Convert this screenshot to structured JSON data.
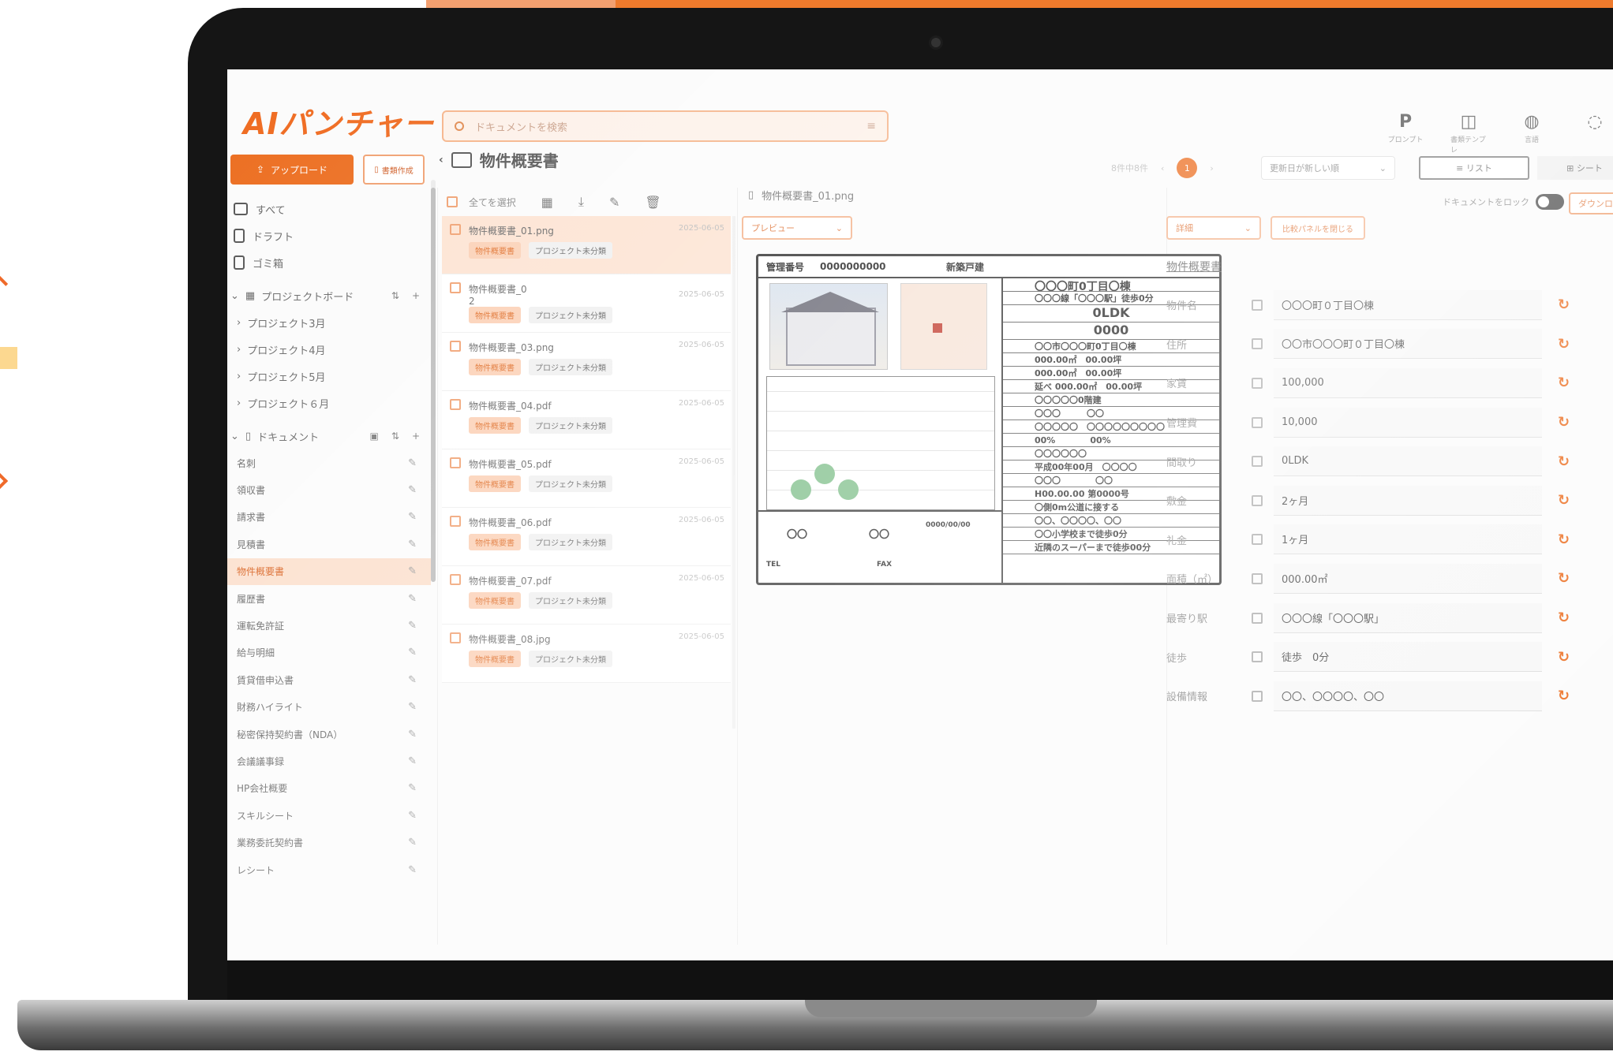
{
  "app": {
    "logo": "AIパンチャー"
  },
  "search": {
    "placeholder": "ドキュメントを検索",
    "menu_glyph": "≡"
  },
  "top_tools": [
    {
      "glyph": "P",
      "label": "プロンプト"
    },
    {
      "glyph": "◫",
      "label": "書類テンプレ"
    },
    {
      "glyph": "◍",
      "label": "言語"
    },
    {
      "glyph": "◌",
      "label": ""
    }
  ],
  "actions": {
    "upload": "アップロード",
    "create_doc": "書類作成"
  },
  "sidebar": {
    "nav": [
      {
        "label": "すべて"
      },
      {
        "label": "ドラフト"
      },
      {
        "label": "ゴミ箱"
      }
    ],
    "project_board": {
      "title": "プロジェクトボード",
      "items": [
        "プロジェクト3月",
        "プロジェクト4月",
        "プロジェクト5月",
        "プロジェクト６月"
      ]
    },
    "documents": {
      "title": "ドキュメント",
      "items": [
        "名刺",
        "領収書",
        "請求書",
        "見積書",
        "物件概要書",
        "履歴書",
        "運転免許証",
        "給与明細",
        "賃貸借申込書",
        "財務ハイライト",
        "秘密保持契約書（NDA）",
        "会議議事録",
        "HP会社概要",
        "スキルシート",
        "業務委託契約書",
        "レシート"
      ],
      "active": "物件概要書"
    }
  },
  "header": {
    "title": "物件概要書",
    "count": "8件中8件",
    "page": "1",
    "sort": "更新日が新しい順",
    "view_list": "≡ リスト",
    "view_sheet": "⊞ シート"
  },
  "list": {
    "select_all": "全てを選択",
    "files": [
      {
        "name": "物件概要書_01.png",
        "date": "2025-06-05",
        "tag": "物件概要書",
        "project": "プロジェクト未分類"
      },
      {
        "name": "物件概要書_0\n2",
        "date": "2025-06-05",
        "tag": "物件概要書",
        "project": "プロジェクト未分類"
      },
      {
        "name": "物件概要書_03.png",
        "date": "2025-06-05",
        "tag": "物件概要書",
        "project": "プロジェクト未分類"
      },
      {
        "name": "物件概要書_04.pdf",
        "date": "2025-06-05",
        "tag": "物件概要書",
        "project": "プロジェクト未分類"
      },
      {
        "name": "物件概要書_05.pdf",
        "date": "2025-06-05",
        "tag": "物件概要書",
        "project": "プロジェクト未分類"
      },
      {
        "name": "物件概要書_06.pdf",
        "date": "2025-06-05",
        "tag": "物件概要書",
        "project": "プロジェクト未分類"
      },
      {
        "name": "物件概要書_07.pdf",
        "date": "2025-06-05",
        "tag": "物件概要書",
        "project": "プロジェクト未分類"
      },
      {
        "name": "物件概要書_08.jpg",
        "date": "2025-06-05",
        "tag": "物件概要書",
        "project": "プロジェクト未分類"
      }
    ]
  },
  "preview": {
    "filename": "物件概要書_01.png",
    "mode": "プレビュー",
    "doc": {
      "mgmt_no_label": "管理番号",
      "mgmt_no": "0000000000",
      "type": "新築戸建",
      "lines": [
        "〇〇〇町0丁目〇棟",
        "〇〇〇線「〇〇〇駅」徒歩0分",
        "0LDK",
        "0000",
        "〇〇市〇〇〇町0丁目〇棟",
        "000.00㎡　00.00坪",
        "000.00㎡　00.00坪",
        "延べ 000.00㎡　00.00坪",
        "〇〇〇〇〇0階建",
        "〇〇〇　　　〇〇",
        "〇〇〇〇〇　〇〇〇〇〇〇〇〇〇",
        "00%　　　　00%",
        "〇〇〇〇〇〇",
        "平成00年00月　〇〇〇〇",
        "〇〇〇　　　　〇〇",
        "H00.00.00 第0000号",
        "〇側0m公道に接する",
        "〇〇、〇〇〇〇、〇〇",
        "〇〇小学校まで徒歩0分",
        "近隣のスーパーまで徒歩00分"
      ],
      "bottom": {
        "a": "〇〇",
        "b": "〇〇",
        "date": "0000/00/00",
        "tel": "TEL",
        "fax": "FAX"
      }
    }
  },
  "detail": {
    "mode": "詳細",
    "close_compare": "比較パネルを閉じる",
    "lock_label": "ドキュメントをロック",
    "download": "ダウンロ",
    "title": "物件概要書",
    "fields": [
      {
        "label": "物件名",
        "value": "〇〇〇町０丁目〇棟"
      },
      {
        "label": "住所",
        "value": "〇〇市〇〇〇町０丁目〇棟"
      },
      {
        "label": "家賃",
        "value": "100,000"
      },
      {
        "label": "管理費",
        "value": "10,000"
      },
      {
        "label": "間取り",
        "value": "0LDK"
      },
      {
        "label": "敷金",
        "value": "2ヶ月"
      },
      {
        "label": "礼金",
        "value": "1ヶ月"
      },
      {
        "label": "面積（㎡）",
        "value": "000.00㎡"
      },
      {
        "label": "最寄り駅",
        "value": "〇〇〇線「〇〇〇駅」"
      },
      {
        "label": "徒歩",
        "value": "徒歩　0分"
      },
      {
        "label": "設備情報",
        "value": "〇〇、〇〇〇〇、〇〇"
      }
    ]
  },
  "colors": {
    "accent": "#ec6d1f",
    "accent_light": "#fbd0b5",
    "bezel": "#151515"
  }
}
